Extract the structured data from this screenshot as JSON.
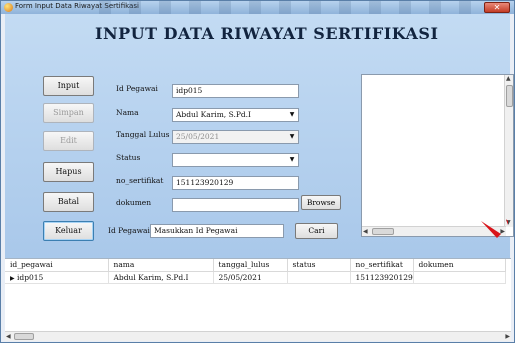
{
  "window": {
    "title": "Form Input Data Riwayat Sertifikasi"
  },
  "heading": "INPUT DATA RIWAYAT  SERTIFIKASI",
  "buttons": {
    "input": "Input",
    "simpan": "Simpan",
    "edit": "Edit",
    "hapus": "Hapus",
    "batal": "Batal",
    "keluar": "Keluar"
  },
  "form": {
    "id_pegawai_label": "Id Pegawai",
    "id_pegawai_value": "idp015",
    "nama_label": "Nama",
    "nama_value": "Abdul Karim, S.Pd.I",
    "tanggal_label": "Tanggal Lulus",
    "tanggal_value": "25/05/2021",
    "status_label": "Status",
    "status_value": "",
    "sertifikat_label": "no_sertifikat",
    "sertifikat_value": "151123920129",
    "dokumen_label": "dokumen",
    "dokumen_value": "",
    "browse_label": "Browse"
  },
  "search": {
    "label": "Id Pegawai",
    "placeholder": "Masukkan Id Pegawai",
    "button": "Cari"
  },
  "grid": {
    "columns": [
      "id_pegawai",
      "nama",
      "tanggal_lulus",
      "status",
      "no_sertifikat",
      "dokumen"
    ],
    "rows": [
      [
        "idp015",
        "Abdul Karim, S.Pd.I",
        "25/05/2021",
        "",
        "151123920129",
        ""
      ]
    ]
  },
  "colors": {
    "form_bg": "#b6d1ee",
    "accent_red": "#d9141a"
  }
}
